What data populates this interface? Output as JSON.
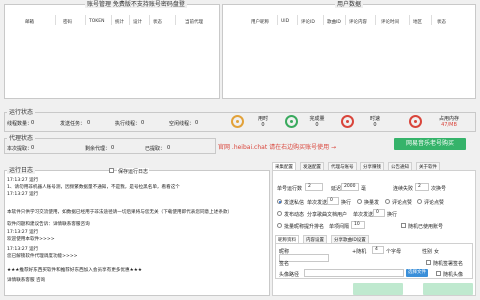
{
  "accounts": {
    "title": "账号管理  免费版不支持账号密码盘登",
    "columns": [
      "邮箱",
      "密码",
      "TOKEN",
      "统计",
      "设计",
      "状态",
      "当前代理"
    ]
  },
  "userdata": {
    "title": "用户数据",
    "columns": [
      "用户昵称",
      "UID",
      "评论ID",
      "歌曲ID",
      "评论内容",
      "评论时间",
      "地区",
      "状态"
    ]
  },
  "run_status": {
    "title": "运行状态",
    "fields": [
      {
        "label": "线程数量：",
        "value": "0"
      },
      {
        "label": "发送任务：",
        "value": "0"
      },
      {
        "label": "执行线程：",
        "value": "0"
      },
      {
        "label": "空闲线程：",
        "value": "0"
      }
    ],
    "gauges": [
      {
        "label": "用时",
        "value": "0",
        "color": "#e2a23a",
        "icon": "clock-icon"
      },
      {
        "label": "完成量",
        "value": "0",
        "color": "#3aaa5e",
        "icon": "check-icon"
      },
      {
        "label": "时速",
        "value": "0",
        "color": "#d9453b",
        "icon": "speed-icon"
      },
      {
        "label": "占用内存",
        "value": "47/MB",
        "color": "#d9453b",
        "icon": "memory-icon"
      }
    ]
  },
  "proxy_status": {
    "title": "代理状态",
    "fields": [
      {
        "label": "本次提取：",
        "value": "0"
      },
      {
        "label": "剩余代理：",
        "value": "0"
      },
      {
        "label": "已提取：",
        "value": "0"
      }
    ]
  },
  "promo": {
    "text": "官网 .heibai.chat 请在右边购买账号使用 →",
    "buy_button": "网易音乐老号购买"
  },
  "runlog": {
    "title": "运行日志",
    "save_label": "保存运行日志",
    "lines": [
      "17:13:27 运行",
      "1、请勿用非机器人账号测，因频繁数据量不通知，不是我，是号拉黑名单，看看这个",
      "17:13:27 运行",
      "",
      "本软件只供学习交流使用，如数据已经用于非法途径请一切后果将与您无关（下载使用即代表您同意上述条款）",
      "软件问题和建议告诉：详情联系客服咨询",
      "17:13:27 运行",
      "           欢迎使用本软件>>>>",
      "17:13:27 运行",
      "           您已解锁软件代理调度功能>>>>",
      "",
      "★★★推荐好东西买软件和推荐好东西加入会员享有更多优惠★★★",
      "详情联系客服  咨询"
    ]
  },
  "settings": {
    "tabs": [
      "采集配置",
      "发送配置",
      "代理与账号",
      "分享赚钱",
      "公告通知",
      "关于软件"
    ],
    "single_thread_label": "单号运行数",
    "single_thread_value": "2",
    "delay_label": "延迟",
    "delay_value": "2000",
    "delay_unit": "毫",
    "continuous_label": "连续失败",
    "continuous_value": "2",
    "continuous_unit": "次换号",
    "radio_row1": [
      "发送私信",
      "单次发送",
      "换行",
      "换量发",
      "评论点赞",
      "评论点赞"
    ],
    "row1_value": "0",
    "radio_row2": [
      "发布动态",
      "分享歌曲文档用户",
      "单次发送",
      "换行"
    ],
    "row2_value": "0",
    "radio_row3": [
      "批量昵称提升排名",
      "单项间隔",
      "随机已使用账号"
    ],
    "row3_value": "10",
    "subtabs": [
      "昵称资料",
      "内容设置",
      "分享歌曲ID设置"
    ],
    "nickname_label": "昵称",
    "nickname_value": "",
    "prefix_label": "+随机",
    "prefix_value": "4",
    "prefix_unit": "个字母",
    "gender_label": "性别",
    "gender_value": "女",
    "signature_label": "签名",
    "random_sig_label": "随机签署签名",
    "avatar_label": "头像路径",
    "avatar_value": "",
    "choose_file_label": "选择文件",
    "random_avatar_label": "随机头像",
    "start_button": "",
    "stop_button": ""
  }
}
